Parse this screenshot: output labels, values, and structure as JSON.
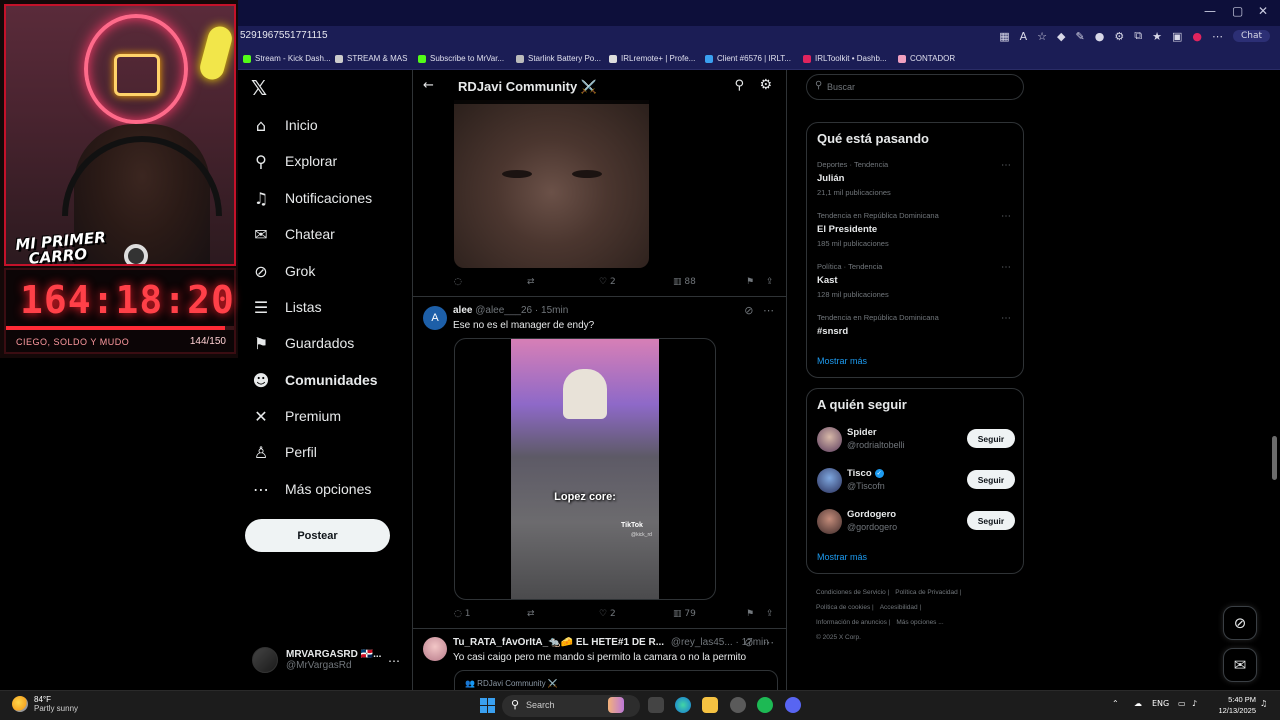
{
  "browser": {
    "url": "5291967551771115",
    "chat_label": "Chat",
    "bookmarks": [
      {
        "label": "Stream - Kick Dash...",
        "color": "#53fc18"
      },
      {
        "label": "STREAM & MAS",
        "color": "#cccccc"
      },
      {
        "label": "Subscribe to MrVar...",
        "color": "#53fc18"
      },
      {
        "label": "Starlink Battery Po...",
        "color": "#bbbbbb"
      },
      {
        "label": "IRLremote+ | Profe...",
        "color": "#dddddd"
      },
      {
        "label": "Client #6576 | IRLT...",
        "color": "#3aa0f0"
      },
      {
        "label": "IRLToolkit • Dashb...",
        "color": "#e0245e"
      },
      {
        "label": "CONTADOR",
        "color": "#f0a0c0"
      }
    ]
  },
  "stream_overlay": {
    "badge_line1": "MI PRIMER",
    "badge_line2": "CARRO",
    "timer": "164:18:20",
    "goal_label": "CIEGO, SOLDO Y MUDO",
    "goal_count": "144/150",
    "goal_fraction": 0.96,
    "accent": "#ff2b36"
  },
  "sidebar": {
    "items": [
      {
        "label": "Inicio",
        "icon": "home-icon",
        "glyph": "⌂"
      },
      {
        "label": "Explorar",
        "icon": "search-icon",
        "glyph": "⚲"
      },
      {
        "label": "Notificaciones",
        "icon": "bell-icon",
        "glyph": "♫"
      },
      {
        "label": "Chatear",
        "icon": "mail-icon",
        "glyph": "✉"
      },
      {
        "label": "Grok",
        "icon": "grok-icon",
        "glyph": "⊘"
      },
      {
        "label": "Listas",
        "icon": "list-icon",
        "glyph": "☰"
      },
      {
        "label": "Guardados",
        "icon": "bookmark-icon",
        "glyph": "⚑"
      },
      {
        "label": "Comunidades",
        "icon": "communities-icon",
        "glyph": "☻"
      },
      {
        "label": "Premium",
        "icon": "x-icon",
        "glyph": "✕"
      },
      {
        "label": "Perfil",
        "icon": "user-icon",
        "glyph": "♙"
      },
      {
        "label": "Más opciones",
        "icon": "more-icon",
        "glyph": "⋯"
      }
    ],
    "post_label": "Postear",
    "account": {
      "name": "MRVARGASRD 🇩🇴...",
      "handle": "@MrVargasRd"
    }
  },
  "feed": {
    "title": "RDJavi Community ⚔️",
    "tweets": [
      {
        "replies": "",
        "retweets": "",
        "likes": "2",
        "views": "88"
      },
      {
        "name": "alee",
        "handle": "@alee___26",
        "time": "· 15min",
        "text": "Ese no es el manager de endy?",
        "video_caption": "Lopez core:",
        "tiktok_label": "TikTok",
        "tiktok_user": "@kick_rd",
        "replies": "1",
        "retweets": "",
        "likes": "2",
        "views": "79"
      },
      {
        "name": "Tu_RATA_fAvOrItA_🐀🧀 EL HETE#1 DE R...",
        "handle": "@rey_las45...",
        "time": "· 17min",
        "text": "Yo casi caigo pero me mando si permito la camara o no la permito",
        "quote": "👥 RDJavi Community ⚔️"
      }
    ]
  },
  "right": {
    "search_placeholder": "Buscar",
    "trends_title": "Qué está pasando",
    "trends": [
      {
        "meta": "Deportes · Tendencia",
        "name": "Julián",
        "count": "21,1 mil publicaciones"
      },
      {
        "meta": "Tendencia en República Dominicana",
        "name": "El Presidente",
        "count": "185 mil publicaciones"
      },
      {
        "meta": "Política · Tendencia",
        "name": "Kast",
        "count": "128 mil publicaciones"
      },
      {
        "meta": "Tendencia en República Dominicana",
        "name": "#snsrd",
        "count": ""
      }
    ],
    "show_more": "Mostrar más",
    "follow_title": "A quién seguir",
    "follow": [
      {
        "name": "Spider",
        "handle": "@rodrialtobelli",
        "verified": false,
        "button": "Seguir"
      },
      {
        "name": "Tisco",
        "handle": "@Tiscofn",
        "verified": true,
        "button": "Seguir"
      },
      {
        "name": "Gordogero",
        "handle": "@gordogero",
        "verified": false,
        "button": "Seguir"
      }
    ],
    "footer": [
      "Condiciones de Servicio |",
      "Política de Privacidad |",
      "Política de cookies |",
      "Accesibilidad |",
      "Información de anuncios |",
      "Más opciones ...",
      "© 2025 X Corp."
    ]
  },
  "taskbar": {
    "temp": "84°F",
    "weather": "Partly sunny",
    "search_label": "Search",
    "lang": "ENG",
    "time": "5:40 PM",
    "date": "12/13/2025"
  }
}
